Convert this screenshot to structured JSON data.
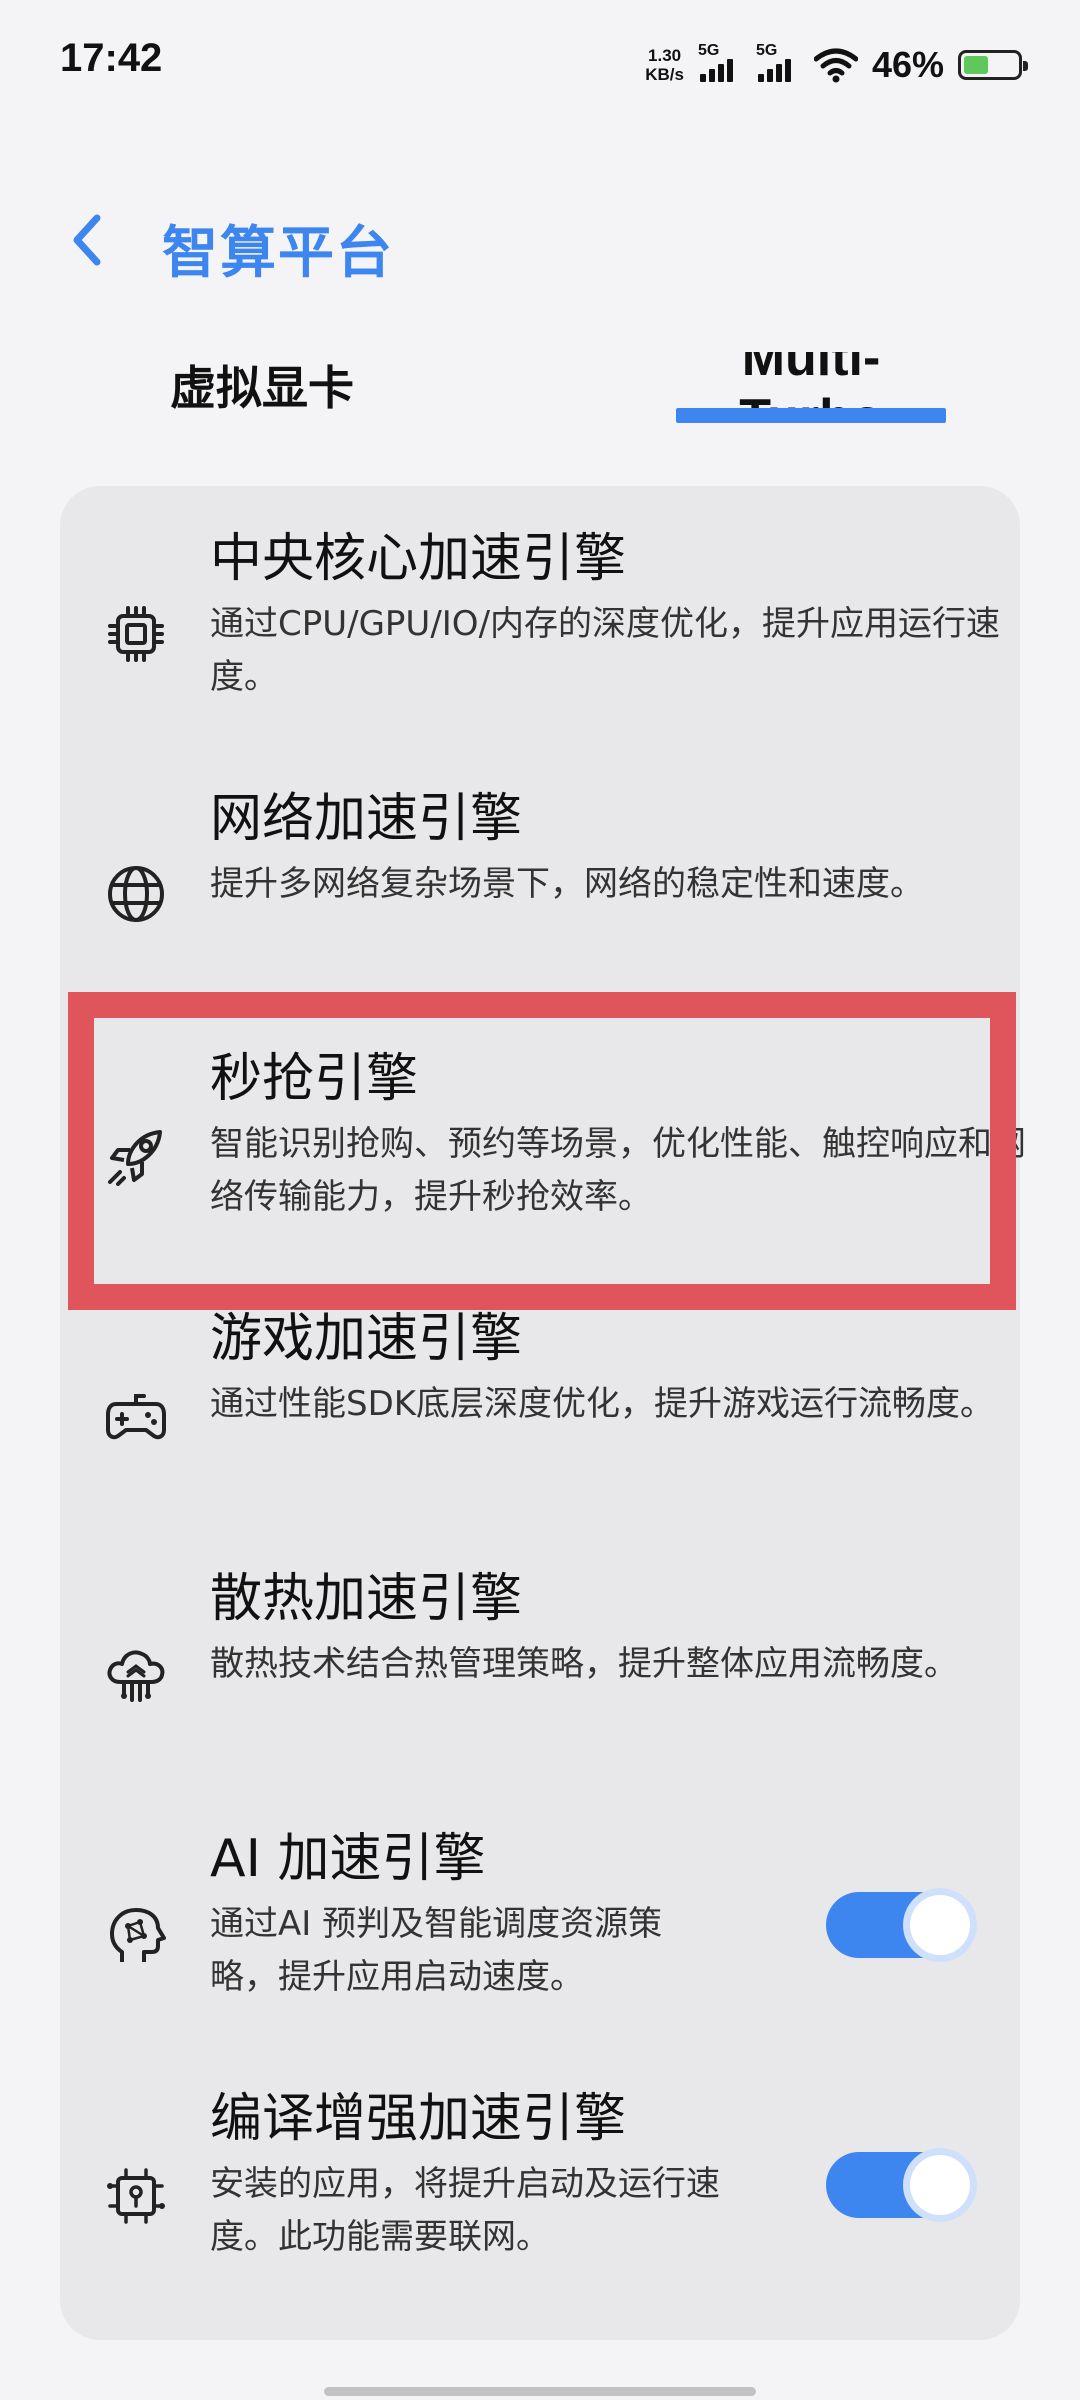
{
  "status_bar": {
    "time": "17:42",
    "net_speed_value": "1.30",
    "net_speed_unit": "KB/s",
    "sim1_tag": "5G",
    "sim2_tag": "5G",
    "battery_percent": "46%",
    "battery_level": 0.46,
    "battery_color": "#5fc85a"
  },
  "header": {
    "title": "智算平台",
    "accent_color": "#3d86f0"
  },
  "tabs": [
    {
      "label": "虚拟显卡",
      "selected": false
    },
    {
      "label": "Multi-Turbo",
      "selected": true
    }
  ],
  "engines": [
    {
      "title": "中央核心加速引擎",
      "desc": "通过CPU/GPU/IO/内存的深度优化，提升应用运行速度。",
      "icon": "cpu-chip-icon"
    },
    {
      "title": "网络加速引擎",
      "desc": "提升多网络复杂场景下，网络的稳定性和速度。",
      "icon": "globe-icon"
    },
    {
      "title": "秒抢引擎",
      "desc": "智能识别抢购、预约等场景，优化性能、触控响应和网络传输能力，提升秒抢效率。",
      "icon": "rocket-icon"
    },
    {
      "title": "游戏加速引擎",
      "desc": "通过性能SDK底层深度优化，提升游戏运行流畅度。",
      "icon": "gamepad-icon"
    },
    {
      "title": "散热加速引擎",
      "desc": "散热技术结合热管理策略，提升整体应用流畅度。",
      "icon": "cooling-cloud-icon"
    },
    {
      "title": "AI 加速引擎",
      "desc": "通过AI 预判及智能调度资源策略，提升应用启动速度。",
      "icon": "ai-head-icon",
      "toggle_on": true
    },
    {
      "title": "编译增强加速引擎",
      "desc": "安装的应用，将提升启动及运行速度。此功能需要联网。",
      "icon": "compile-chip-icon",
      "toggle_on": true
    }
  ],
  "highlight_color": "#e0545c"
}
